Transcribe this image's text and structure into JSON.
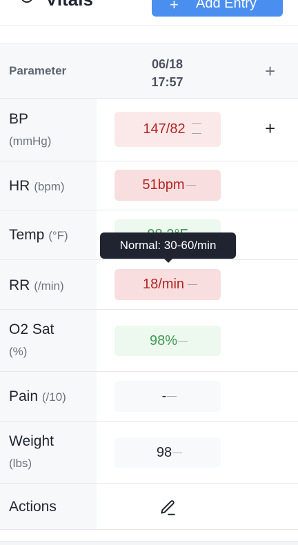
{
  "header": {
    "title": "Vitals",
    "add_entry_label": "Add Entry",
    "add_entry_icon": "plus-icon"
  },
  "table": {
    "param_header": "Parameter",
    "columns": [
      {
        "date": "06/18",
        "time": "17:57"
      }
    ],
    "add_column_icon": "+",
    "rows": [
      {
        "name": "BP",
        "unit": "(mmHg)",
        "value": "147/82",
        "status": "high"
      },
      {
        "name": "HR",
        "unit": "(bpm)",
        "value": "51bpm",
        "status": "abnormal"
      },
      {
        "name": "Temp",
        "unit": "(°F)",
        "value": "98.2°F",
        "status": "normal"
      },
      {
        "name": "RR",
        "unit": "(/min)",
        "value": "18/min",
        "status": "abnormal"
      },
      {
        "name": "O2 Sat",
        "unit": "(%)",
        "value": "98%",
        "status": "normal"
      },
      {
        "name": "Pain",
        "unit": "(/10)",
        "value": "-",
        "status": "empty"
      },
      {
        "name": "Weight",
        "unit": "(lbs)",
        "value": "98",
        "status": "empty"
      }
    ],
    "actions_label": "Actions",
    "row_add_icon": "+"
  },
  "tooltip": {
    "text": "Normal: 30-60/min"
  },
  "colors": {
    "accent": "#4a8ef0",
    "high_bg": "#fbe9e9",
    "abnormal_bg": "#f8dede",
    "abnormal_text": "#b42323",
    "normal_bg": "#edf8ef",
    "normal_text": "#3f9a50"
  }
}
